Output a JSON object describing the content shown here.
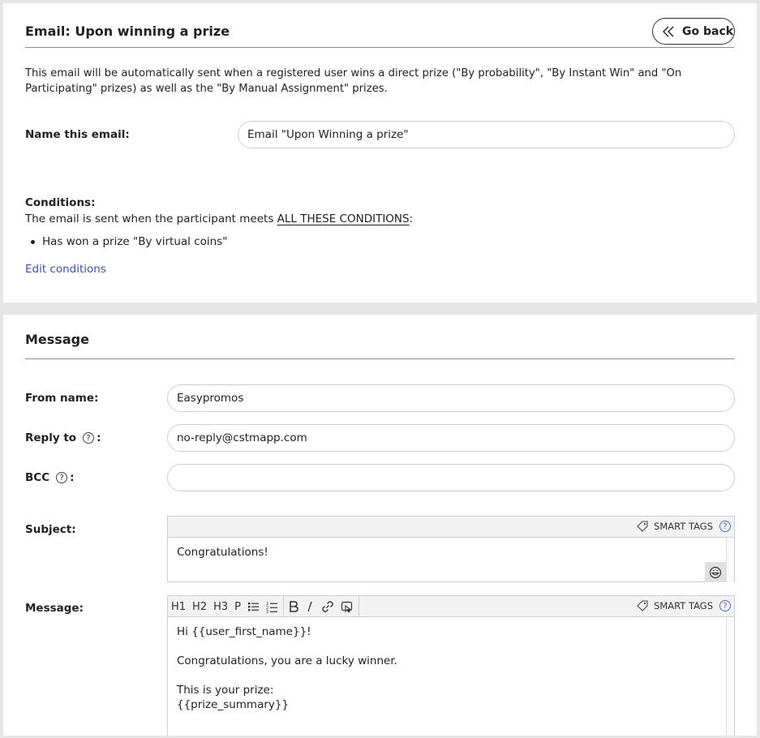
{
  "header": {
    "title": "Email: Upon winning a prize",
    "go_back_label": "Go back"
  },
  "description": "This email will be automatically sent when a registered user wins a direct prize (\"By probability\", \"By Instant Win\" and \"On Participating\" prizes) as well as the \"By Manual Assignment\" prizes.",
  "name_email": {
    "label": "Name this email:",
    "value": "Email \"Upon Winning a prize\""
  },
  "conditions": {
    "label": "Conditions:",
    "intro": "The email is sent when the participant meets ",
    "emphasis": "ALL THESE CONDITIONS",
    "colon": ":",
    "items": [
      "Has won a prize \"By virtual coins\""
    ],
    "edit_link": "Edit conditions"
  },
  "message_section": {
    "title": "Message",
    "from_name": {
      "label": "From name:",
      "value": "Easypromos"
    },
    "reply_to": {
      "label": "Reply to",
      "suffix": ":",
      "value": "no-reply@cstmapp.com"
    },
    "bcc": {
      "label": "BCC",
      "suffix": ":",
      "value": ""
    },
    "subject": {
      "label": "Subject:",
      "value": "Congratulations!",
      "smart_tags": "SMART TAGS"
    },
    "message": {
      "label": "Message:",
      "smart_tags": "SMART TAGS",
      "toolbar": [
        "H1",
        "H2",
        "H3",
        "P"
      ],
      "lines": [
        "Hi {{user_first_name}}!",
        "",
        "Congratulations, you are a lucky winner.",
        "",
        "This is your prize:",
        "{{prize_summary}}"
      ]
    }
  },
  "icons": {
    "go_back": "double-chevron-left-icon",
    "help": "question-circle-icon",
    "smart_tags": "tag-icon",
    "emoji": "smiley-icon",
    "bold": "bold-icon",
    "italic": "italic-icon",
    "link": "link-icon",
    "bullet_list": "bullet-list-icon",
    "numbered_list": "numbered-list-icon",
    "image": "image-icon"
  },
  "colors": {
    "link": "#3f51b5",
    "help_accent": "#4a6ad0"
  }
}
